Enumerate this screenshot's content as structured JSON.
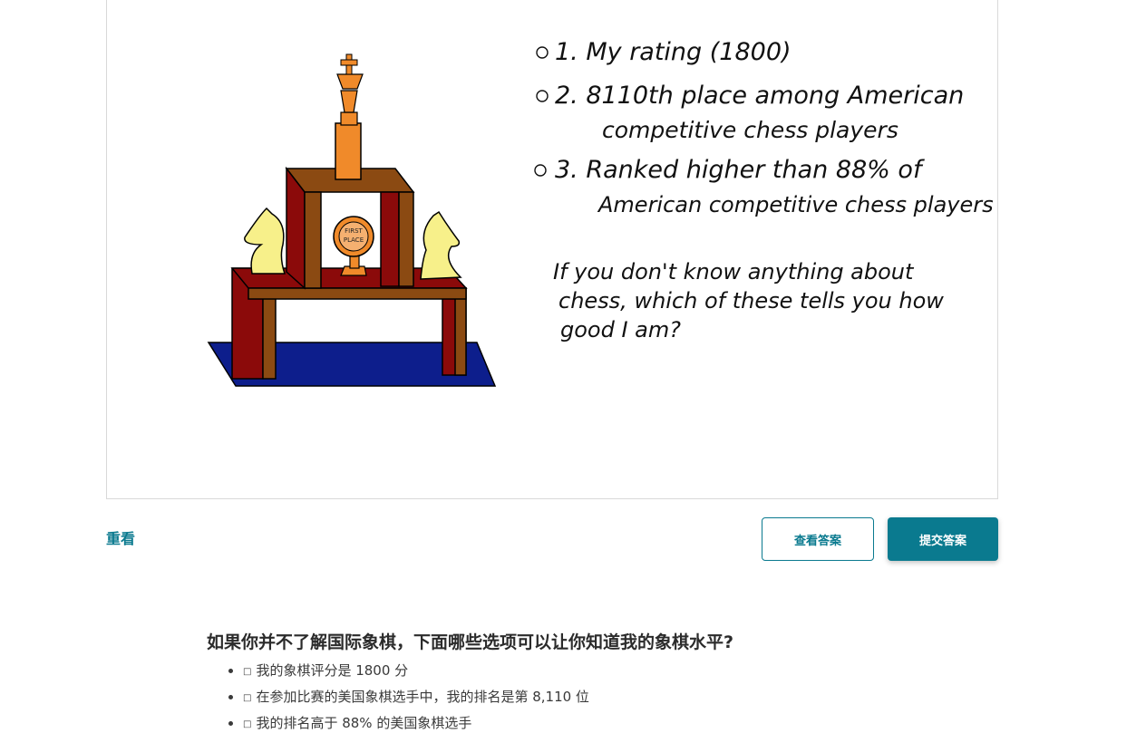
{
  "video": {
    "handwriting": {
      "option1": "1. My rating (1800)",
      "option2_line1": "2. 8110th place among American",
      "option2_line2": "competitive chess players",
      "option3_line1": "3. Ranked higher than 88% of",
      "option3_line2": "American competitive chess players",
      "prompt_line1": "If you don't know anything about",
      "prompt_line2": "chess, which of these tells you how",
      "prompt_line3": "good I am?",
      "medal_line1": "FIRST",
      "medal_line2": "PLACE"
    }
  },
  "controls": {
    "replay_label": "重看",
    "show_answer_label": "查看答案",
    "submit_label": "提交答案"
  },
  "question": {
    "title": "如果你并不了解国际象棋，下面哪些选项可以让你知道我的象棋水平?",
    "options": [
      "我的象棋评分是 1800 分",
      "在参加比赛的美国象棋选手中，我的排名是第 8,110 位",
      "我的排名高于 88% 的美国象棋选手"
    ]
  },
  "colors": {
    "accent": "#0a7a8f",
    "podium_red": "#8b0a0a",
    "podium_brown": "#8b4a12",
    "rug_blue": "#0d1e8c",
    "trophy_orange": "#f08a2a",
    "knight_yellow": "#f7f08a"
  }
}
